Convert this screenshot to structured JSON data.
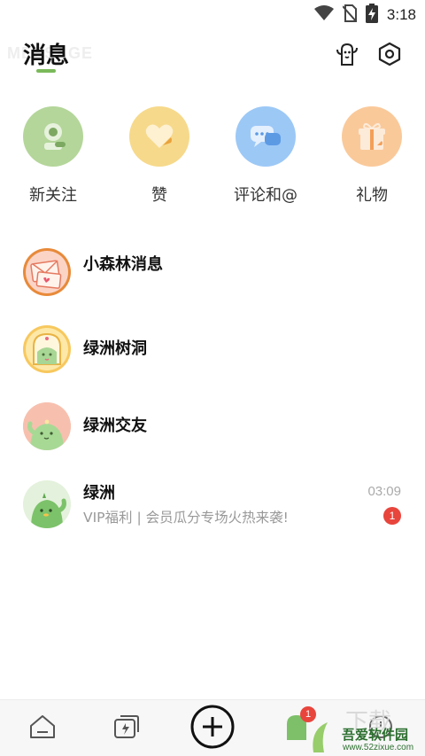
{
  "status_bar": {
    "time": "3:18",
    "icons": [
      "wifi-icon",
      "no-sim-icon",
      "battery-charging-icon"
    ]
  },
  "header": {
    "watermark_text": "MESSAGE",
    "title": "消息",
    "actions": [
      "cactus-sticker-icon",
      "settings-hexagon-icon"
    ]
  },
  "quick_entries": [
    {
      "label": "新关注",
      "icon": "follow-camera-icon",
      "color": "#a9cf8e"
    },
    {
      "label": "赞",
      "icon": "heart-icon",
      "color": "#f5d27c"
    },
    {
      "label": "评论和@",
      "icon": "comment-bubble-icon",
      "color": "#8ec0f4"
    },
    {
      "label": "礼物",
      "icon": "gift-icon",
      "color": "#f9c48f"
    }
  ],
  "conversations": [
    {
      "name": "小森林消息",
      "preview": "",
      "time": "",
      "unread": "",
      "avatar": "envelope-avatar"
    },
    {
      "name": "绿洲树洞",
      "preview": "",
      "time": "",
      "unread": "",
      "avatar": "tree-hole-avatar"
    },
    {
      "name": "绿洲交友",
      "preview": "",
      "time": "",
      "unread": "",
      "avatar": "cactus-pink-avatar"
    },
    {
      "name": "绿洲",
      "preview": "VIP福利 | 会员瓜分专场火热来袭!",
      "time": "03:09",
      "unread": "1",
      "avatar": "cactus-green-avatar"
    }
  ],
  "tab_bar": {
    "tabs": [
      "home-icon",
      "card-lightning-icon",
      "add-plus-icon",
      "message-cactus-icon",
      "profile-icon"
    ],
    "message_badge": "1"
  },
  "watermark": {
    "brand": "吾爱软件园",
    "url": "www.52zixue.com"
  },
  "colors": {
    "accent_green": "#7bb95a",
    "badge_red": "#e8453c"
  }
}
